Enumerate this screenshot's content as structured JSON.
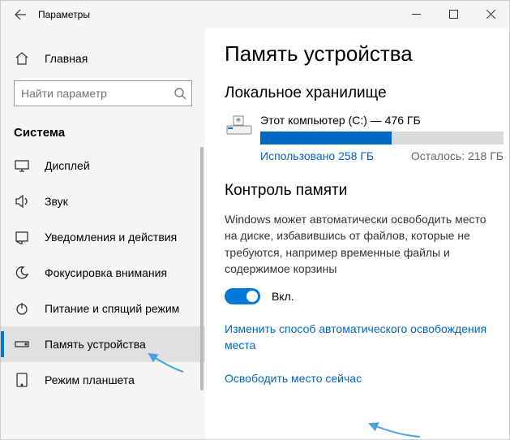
{
  "titlebar": {
    "title": "Параметры"
  },
  "sidebar": {
    "home": "Главная",
    "search_placeholder": "Найти параметр",
    "group": "Система",
    "items": [
      {
        "label": "Дисплей"
      },
      {
        "label": "Звук"
      },
      {
        "label": "Уведомления и действия"
      },
      {
        "label": "Фокусировка внимания"
      },
      {
        "label": "Питание и спящий режим"
      },
      {
        "label": "Память устройства"
      },
      {
        "label": "Режим планшета"
      }
    ]
  },
  "page": {
    "title": "Память устройства",
    "local_storage_heading": "Локальное хранилище",
    "drive": {
      "name": "Этот компьютер (C:) — 476 ГБ",
      "used_label": "Использовано 258 ГБ",
      "free_label": "Осталось: 218 ГБ"
    },
    "sense_heading": "Контроль памяти",
    "sense_description": "Windows может автоматически освободить место на диске, избавившись от файлов, которые не требуются, например временные файлы и содержимое корзины",
    "toggle_label": "Вкл.",
    "link_change": "Изменить способ автоматического освобождения места",
    "link_free_now": "Освободить место сейчас"
  }
}
